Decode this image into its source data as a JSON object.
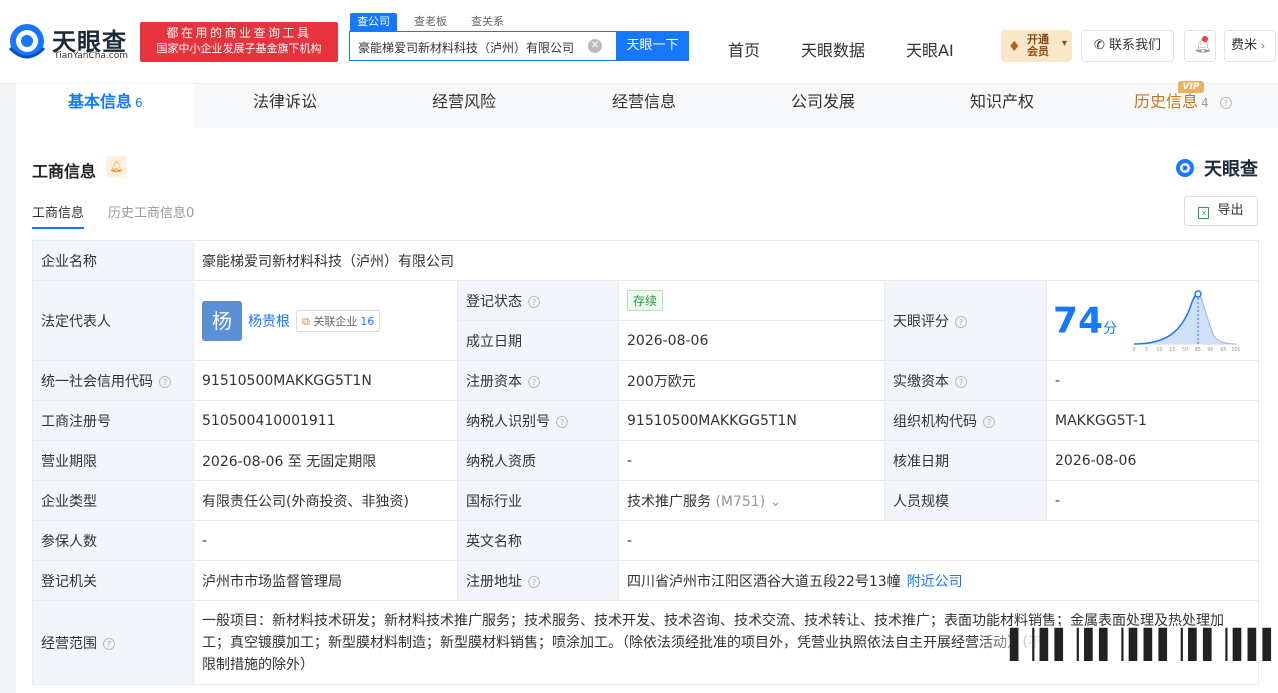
{
  "header": {
    "logo_cn": "天眼查",
    "logo_en": "TianYanCha.com",
    "slogan_line1": "都在用的商业查询工具",
    "slogan_line2": "国家中小企业发展子基金旗下机构",
    "search_tabs": [
      "查公司",
      "查老板",
      "查关系"
    ],
    "search_value": "豪能梯爱司新材料科技（泸州）有限公司",
    "search_button": "天眼一下",
    "nav": [
      "首页",
      "天眼数据",
      "天眼AI"
    ],
    "vip_button": "开通会员",
    "contact_button": "联系我们",
    "user_name": "费米"
  },
  "tabs": [
    {
      "label": "基本信息",
      "count": "6"
    },
    {
      "label": "法律诉讼",
      "count": ""
    },
    {
      "label": "经营风险",
      "count": ""
    },
    {
      "label": "经营信息",
      "count": ""
    },
    {
      "label": "公司发展",
      "count": ""
    },
    {
      "label": "知识产权",
      "count": ""
    },
    {
      "label": "历史信息",
      "count": "4"
    }
  ],
  "vip_tag": "VIP",
  "section": {
    "title": "工商信息",
    "brand": "天眼查",
    "subtabs": [
      "工商信息",
      "历史工商信息0"
    ],
    "export": "导出"
  },
  "info": {
    "company_name_label": "企业名称",
    "company_name": "豪能梯爱司新材料科技（泸州）有限公司",
    "legal_rep_label": "法定代表人",
    "legal_rep_avatar": "杨",
    "legal_rep": "杨贵根",
    "related_label": "关联企业",
    "related_count": "16",
    "reg_status_label": "登记状态",
    "reg_status": "存续",
    "found_date_label": "成立日期",
    "found_date": "2026-08-06",
    "score_label": "天眼评分",
    "score": "74",
    "score_unit": "分",
    "credit_code_label": "统一社会信用代码",
    "credit_code": "91510500MAKKGG5T1N",
    "reg_capital_label": "注册资本",
    "reg_capital": "200万欧元",
    "paid_capital_label": "实缴资本",
    "paid_capital": "-",
    "reg_no_label": "工商注册号",
    "reg_no": "510500410001911",
    "taxpayer_id_label": "纳税人识别号",
    "taxpayer_id": "91510500MAKKGG5T1N",
    "org_code_label": "组织机构代码",
    "org_code": "MAKKGG5T-1",
    "term_label": "营业期限",
    "term": "2026-08-06 至 无固定期限",
    "taxpayer_qual_label": "纳税人资质",
    "taxpayer_qual": "-",
    "approve_date_label": "核准日期",
    "approve_date": "2026-08-06",
    "type_label": "企业类型",
    "type": "有限责任公司(外商投资、非独资)",
    "industry_label": "国标行业",
    "industry": "技术推广服务",
    "industry_code": "(M751)",
    "staff_label": "人员规模",
    "staff": "-",
    "insured_label": "参保人数",
    "insured": "-",
    "en_name_label": "英文名称",
    "en_name": "-",
    "authority_label": "登记机关",
    "authority": "泸州市市场监督管理局",
    "address_label": "注册地址",
    "address": "四川省泸州市江阳区酒谷大道五段22号13幢",
    "nearby": "附近公司",
    "scope_label": "经营范围",
    "scope": "一般项目：新材料技术研发；新材料技术推广服务；技术服务、技术开发、技术咨询、技术交流、技术转让、技术推广；表面功能材料销售；金属表面处理及热处理加工；真空镀膜加工；新型膜材料制造；新型膜材料销售；喷涂加工。（除依法须经批准的项目外，凭营业执照依法自主开展经营活动）（不含外商投资准入负面清单禁止或限制措施的除外）"
  },
  "score_chart": {
    "x_ticks": [
      "0",
      "5",
      "10",
      "15",
      "50",
      "85",
      "90",
      "95",
      "100"
    ]
  },
  "colors": {
    "accent": "#1677ff",
    "slogan": "#e6343f",
    "label_bg": "#f2f5fa"
  }
}
